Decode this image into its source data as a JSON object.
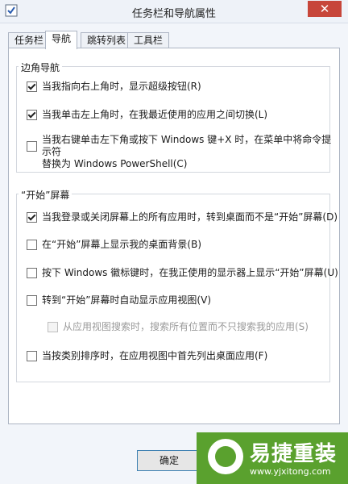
{
  "window": {
    "title": "任务栏和导航属性",
    "close_glyph": "✕"
  },
  "tabs": [
    {
      "label": "任务栏"
    },
    {
      "label": "导航"
    },
    {
      "label": "跳转列表"
    },
    {
      "label": "工具栏"
    }
  ],
  "corner_nav": {
    "heading": "边角导航",
    "options": [
      {
        "label": "当我指向右上角时，显示超级按钮(R)",
        "checked": true
      },
      {
        "label": "当我单击左上角时，在我最近使用的应用之间切换(L)",
        "checked": true
      },
      {
        "label_line1": "当我右键单击左下角或按下 Windows 键+X 时，在菜单中将命令提示符",
        "label_line2": "替换为 Windows PowerShell(C)",
        "checked": false
      }
    ]
  },
  "start_screen": {
    "heading": "“开始”屏幕",
    "options": [
      {
        "label": "当我登录或关闭屏幕上的所有应用时，转到桌面而不是“开始”屏幕(D)",
        "checked": true
      },
      {
        "label": "在“开始”屏幕上显示我的桌面背景(B)",
        "checked": false
      },
      {
        "label": "按下 Windows 徽标键时，在我正使用的显示器上显示“开始”屏幕(U)",
        "checked": false
      },
      {
        "label": "转到“开始”屏幕时自动显示应用视图(V)",
        "checked": false
      },
      {
        "label": "从应用视图搜索时，搜索所有位置而不只搜索我的应用(S)",
        "checked": false,
        "disabled": true
      },
      {
        "label": "当按类别排序时，在应用视图中首先列出桌面应用(F)",
        "checked": false
      }
    ]
  },
  "buttons": {
    "ok": "确定"
  },
  "watermark": {
    "name": "易捷重装",
    "url": "www.yjxitong.com"
  }
}
